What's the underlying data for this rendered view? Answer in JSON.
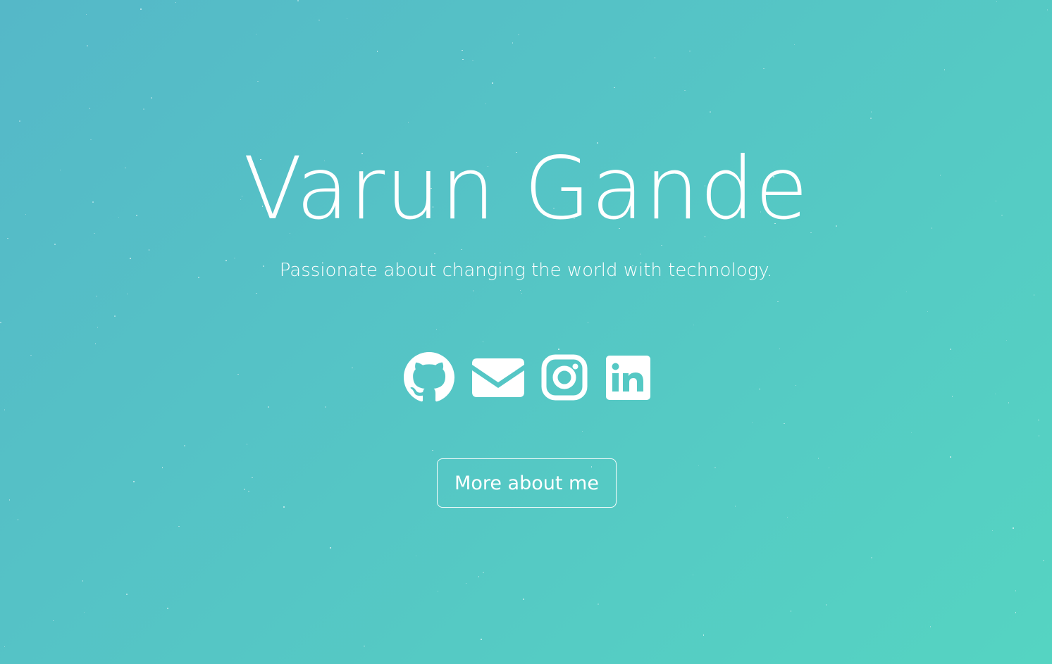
{
  "hero": {
    "title": "Varun Gande",
    "tagline": "Passionate about changing the world with technology.",
    "cta_label": "More about me"
  },
  "socials": [
    {
      "name": "github",
      "icon": "github-icon"
    },
    {
      "name": "email",
      "icon": "envelope-icon"
    },
    {
      "name": "instagram",
      "icon": "instagram-icon"
    },
    {
      "name": "linkedin",
      "icon": "linkedin-icon"
    }
  ],
  "theme": {
    "gradient_start": "#55b8c8",
    "gradient_end": "#55d4c2",
    "text": "#ffffff"
  }
}
